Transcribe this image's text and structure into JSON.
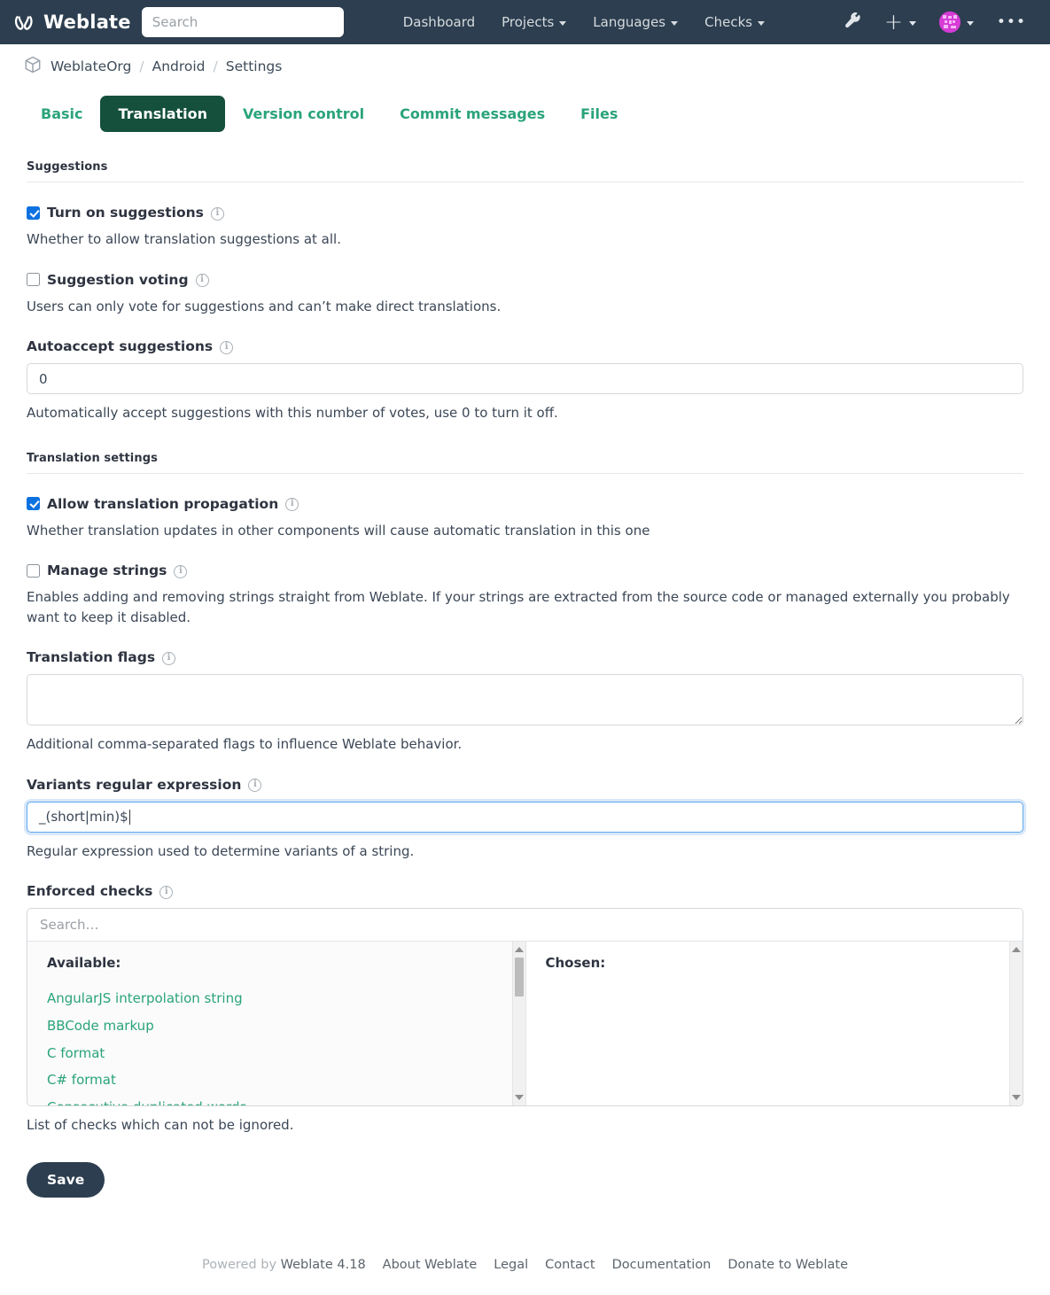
{
  "navbar": {
    "brand": "Weblate",
    "brand_icon": "weblate-logo-icon",
    "search_placeholder": "Search",
    "search_value": "",
    "links": [
      {
        "label": "Dashboard",
        "caret": false
      },
      {
        "label": "Projects",
        "caret": true
      },
      {
        "label": "Languages",
        "caret": true
      },
      {
        "label": "Checks",
        "caret": true
      }
    ],
    "tools_icon": "wrench-icon",
    "add_icon": "plus-icon",
    "avatar_icon": "user-avatar-icon",
    "more_icon": "ellipsis-icon"
  },
  "breadcrumb": {
    "icon": "cube-icon",
    "items": [
      "WeblateOrg",
      "Android",
      "Settings"
    ],
    "separator": "/"
  },
  "tabs": [
    {
      "label": "Basic",
      "active": false
    },
    {
      "label": "Translation",
      "active": true
    },
    {
      "label": "Version control",
      "active": false
    },
    {
      "label": "Commit messages",
      "active": false
    },
    {
      "label": "Files",
      "active": false
    }
  ],
  "sections": {
    "suggestions": {
      "heading": "Suggestions",
      "turn_on": {
        "label": "Turn on suggestions",
        "checked": true,
        "help": "Whether to allow translation suggestions at all."
      },
      "voting": {
        "label": "Suggestion voting",
        "checked": false,
        "help": "Users can only vote for suggestions and can’t make direct translations."
      },
      "autoaccept": {
        "label": "Autoaccept suggestions",
        "value": "0",
        "help": "Automatically accept suggestions with this number of votes, use 0 to turn it off."
      }
    },
    "translation_settings": {
      "heading": "Translation settings",
      "propagation": {
        "label": "Allow translation propagation",
        "checked": true,
        "help": "Whether translation updates in other components will cause automatic translation in this one"
      },
      "manage_strings": {
        "label": "Manage strings",
        "checked": false,
        "help": "Enables adding and removing strings straight from Weblate. If your strings are extracted from the source code or managed externally you probably want to keep it disabled."
      },
      "translation_flags": {
        "label": "Translation flags",
        "value": "",
        "help": "Additional comma-separated flags to influence Weblate behavior."
      },
      "variants_regex": {
        "label": "Variants regular expression",
        "value": "_(short|min)$",
        "help": "Regular expression used to determine variants of a string.",
        "focused": true
      },
      "enforced_checks": {
        "label": "Enforced checks",
        "search_placeholder": "Search…",
        "search_value": "",
        "available_title": "Available:",
        "chosen_title": "Chosen:",
        "available": [
          "AngularJS interpolation string",
          "BBCode markup",
          "C format",
          "C# format",
          "Consecutive duplicated words"
        ],
        "chosen": [],
        "help": "List of checks which can not be ignored."
      }
    }
  },
  "save_button": "Save",
  "footer": {
    "powered_prefix": "Powered by",
    "version": "Weblate 4.18",
    "links": [
      "About Weblate",
      "Legal",
      "Contact",
      "Documentation",
      "Donate to Weblate"
    ]
  },
  "colors": {
    "navbar_bg": "#2c3e4f",
    "tab_active_bg": "#15503c",
    "link_green": "#2aa37b",
    "checkbox_blue": "#0d72e0",
    "focus_blue": "#5fa9ee"
  }
}
